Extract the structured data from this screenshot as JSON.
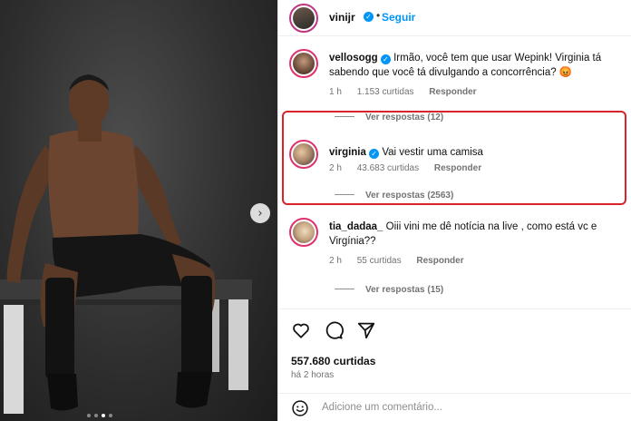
{
  "post": {
    "username": "vinijr",
    "separator": "•",
    "follow_label": "Seguir",
    "carousel_total": 4,
    "carousel_active": 3
  },
  "comments": [
    {
      "username": "vellosogg",
      "text": "Irmão, você tem que usar Wepink! Virginia tá sabendo que você tá divulgando a concorrência? 😡",
      "age": "1 h",
      "likes": "1.153 curtidas",
      "reply_label": "Responder",
      "view_replies": "Ver respostas (12)"
    },
    {
      "username": "virginia",
      "text": "Vai vestir uma camisa",
      "age": "2 h",
      "likes": "43.683 curtidas",
      "reply_label": "Responder",
      "view_replies": "Ver respostas (2563)"
    },
    {
      "username": "tia_dadaa_",
      "text": "Oiii vini me dê notícia na live , como está vc e Virgínia??",
      "age": "2 h",
      "likes": "55 curtidas",
      "reply_label": "Responder",
      "view_replies": "Ver respostas (15)"
    }
  ],
  "footer": {
    "likes": "557.680 curtidas",
    "time_ago": "há 2 horas",
    "comment_placeholder": "Adicione um comentário..."
  },
  "icons": [
    "heart-icon",
    "comment-icon",
    "share-icon",
    "verified-icon",
    "emoji-icon",
    "chevron-right-icon"
  ],
  "colors": {
    "accent": "#0095f6",
    "highlight": "#d8232a"
  }
}
